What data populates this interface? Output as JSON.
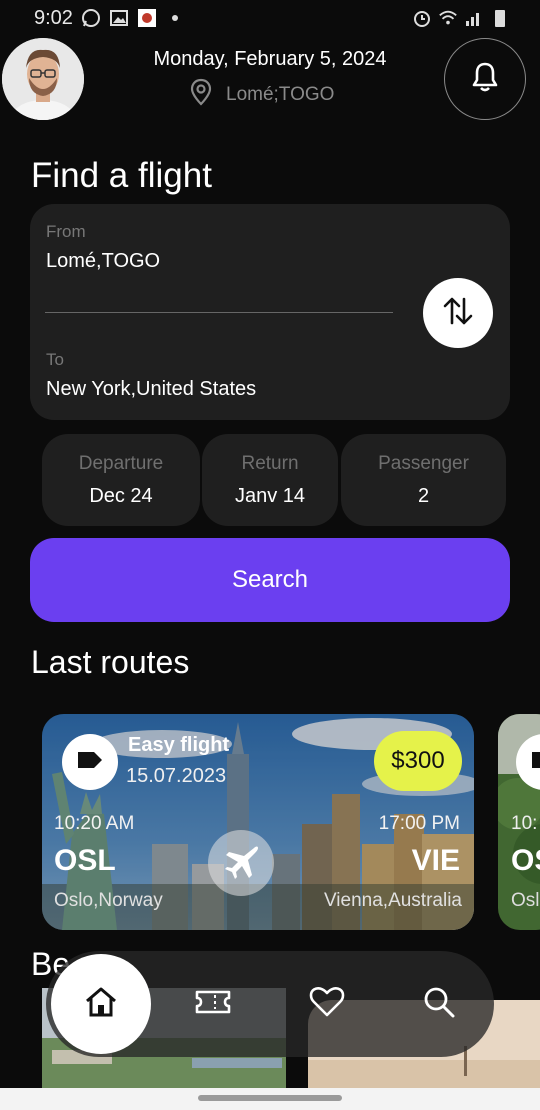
{
  "status_bar": {
    "time": "9:02",
    "icons": [
      "whatsapp-icon",
      "image-icon",
      "app-notification-icon",
      "dot-icon",
      "alarm-icon",
      "wifi-icon",
      "signal-icon",
      "battery-icon"
    ]
  },
  "header": {
    "date": "Monday, February 5, 2024",
    "location": "Lomé;TOGO"
  },
  "search_form": {
    "title": "Find a flight",
    "from_label": "From",
    "from_value": "Lomé,TOGO",
    "to_label": "To",
    "to_value": "New York,United States",
    "departure_label": "Departure",
    "departure_value": "Dec 24",
    "return_label": "Return",
    "return_value": "Janv 14",
    "passenger_label": "Passenger",
    "passenger_value": "2",
    "search_label": "Search"
  },
  "last_routes": {
    "title": "Last routes",
    "cards": [
      {
        "name": "Easy flight",
        "date": "15.07.2023",
        "price": "$300",
        "depart_time": "10:20 AM",
        "arrive_time": "17:00 PM",
        "from_code": "OSL",
        "to_code": "VIE",
        "from_city": "Oslo,Norway",
        "to_city": "Vienna,Australia"
      },
      {
        "depart_time": "10:",
        "from_code": "OS",
        "from_city": "Osl"
      }
    ]
  },
  "second_section": {
    "title_partial": "Be"
  },
  "bottom_nav": {
    "items": [
      "home-icon",
      "ticket-icon",
      "heart-icon",
      "search-icon"
    ],
    "active": "home-icon"
  },
  "colors": {
    "background": "#0b0b0b",
    "card": "#1f1f1f",
    "accent": "#6b3ff0",
    "price_badge": "#e5f24a",
    "muted_text": "#777777"
  }
}
